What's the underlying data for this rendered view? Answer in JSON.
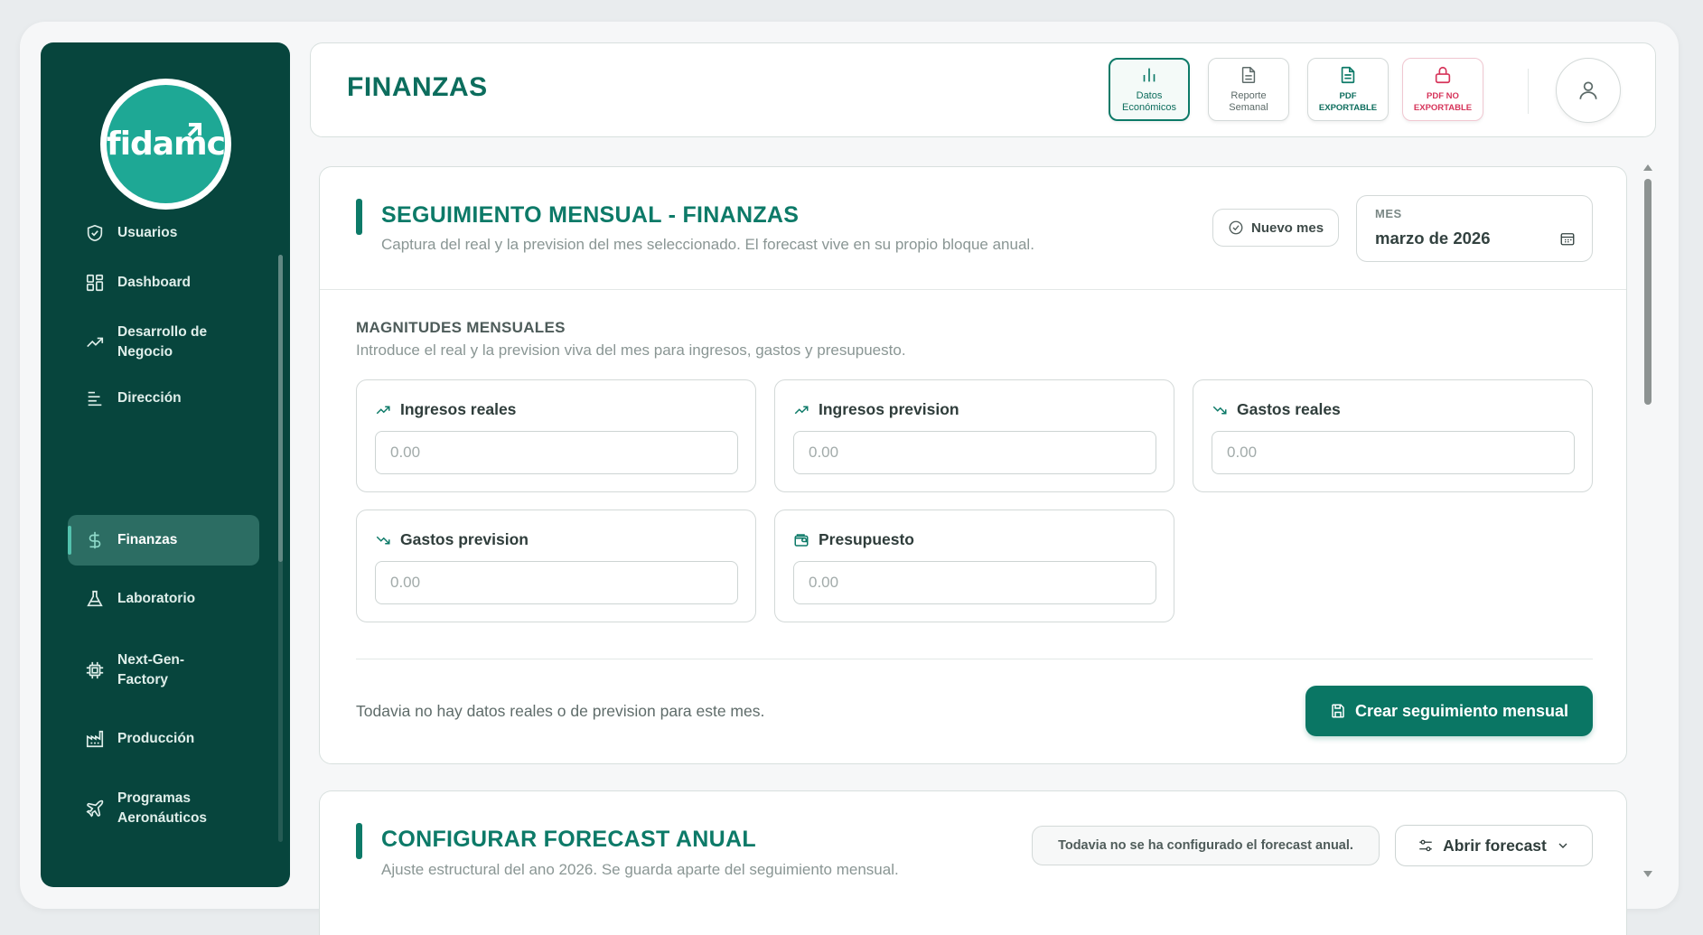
{
  "brand": {
    "logo_text": "fidamc"
  },
  "sidebar": {
    "items": [
      {
        "label": "Usuarios",
        "icon": "shield-check-icon"
      },
      {
        "label": "Dashboard",
        "icon": "layout-grid-icon"
      },
      {
        "label": "Desarrollo de Negocio",
        "icon": "trending-up-icon"
      },
      {
        "label": "Dirección",
        "icon": "align-left-icon"
      },
      {
        "label": "Finanzas",
        "icon": "dollar-icon",
        "active": true
      },
      {
        "label": "Laboratorio",
        "icon": "flask-icon"
      },
      {
        "label": "Next-Gen-Factory",
        "icon": "cpu-icon"
      },
      {
        "label": "Producción",
        "icon": "factory-icon"
      },
      {
        "label": "Programas Aeronáuticos",
        "icon": "plane-icon"
      }
    ]
  },
  "header": {
    "title": "FINANZAS",
    "buttons": [
      {
        "label": "Datos Económicos",
        "icon": "bar-chart-icon",
        "active": true
      },
      {
        "label": "Reporte Semanal",
        "icon": "file-icon"
      },
      {
        "label": "PDF EXPORTABLE",
        "icon": "file-text-icon"
      },
      {
        "label": "PDF NO EXPORTABLE",
        "icon": "lock-icon"
      }
    ],
    "avatar_icon": "user-icon"
  },
  "monthly": {
    "title": "SEGUIMIENTO MENSUAL - FINANZAS",
    "subtitle": "Captura del real y la prevision del mes seleccionado. El forecast vive en su propio bloque anual.",
    "new_month_label": "Nuevo mes",
    "mes_label": "MES",
    "mes_value": "marzo de 2026",
    "group_title": "MAGNITUDES MENSUALES",
    "group_subtitle": "Introduce el real y la prevision viva del mes para ingresos, gastos y presupuesto.",
    "fields": [
      {
        "label": "Ingresos reales",
        "placeholder": "0.00",
        "icon": "trending-up-icon"
      },
      {
        "label": "Ingresos prevision",
        "placeholder": "0.00",
        "icon": "trending-up-icon"
      },
      {
        "label": "Gastos reales",
        "placeholder": "0.00",
        "icon": "trending-down-icon"
      },
      {
        "label": "Gastos prevision",
        "placeholder": "0.00",
        "icon": "trending-down-icon"
      },
      {
        "label": "Presupuesto",
        "placeholder": "0.00",
        "icon": "wallet-icon"
      }
    ],
    "empty_message": "Todavia no hay datos reales o de prevision para este mes.",
    "create_button": "Crear seguimiento mensual"
  },
  "forecast": {
    "title": "CONFIGURAR FORECAST ANUAL",
    "subtitle": "Ajuste estructural del ano 2026. Se guarda aparte del seguimiento mensual.",
    "status_note": "Todavia no se ha configurado el forecast anual.",
    "open_button": "Abrir forecast"
  },
  "colors": {
    "sidebar_bg": "#07453d",
    "accent": "#0d7a68",
    "danger": "#d6345a",
    "logo_bg": "#1ea895"
  }
}
